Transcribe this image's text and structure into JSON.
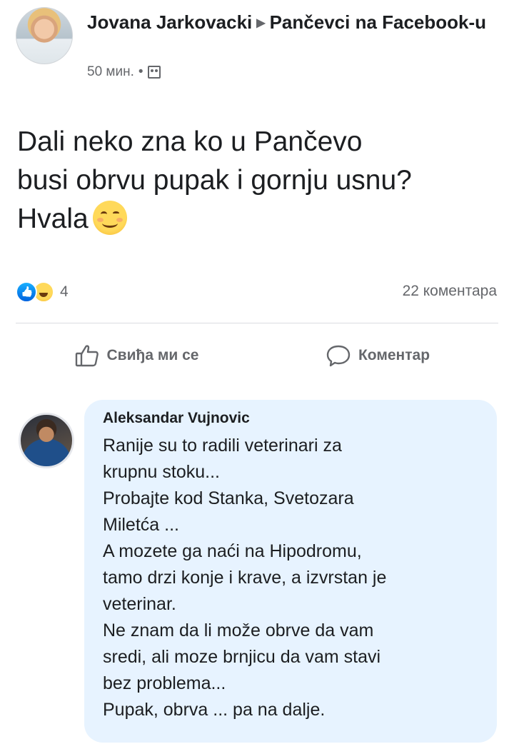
{
  "post": {
    "author": "Jovana Jarkovacki",
    "arrow": "▶",
    "group": "Pančevci na Facebook-u",
    "time": "50 мин.",
    "dot": "•",
    "text_lines": [
      "Dali neko zna ko u Pančevo",
      "busi obrvu pupak i gornju usnu?",
      "Hvala"
    ],
    "reaction_count": "4",
    "comments_count": "22 коментара",
    "like_label": "Свиђа ми се",
    "comment_label": "Коментар"
  },
  "comment": {
    "author": "Aleksandar Vujnovic",
    "lines": [
      "Ranije su to radili veterinari za",
      "krupnu stoku...",
      "Probajte kod Stanka, Svetozara",
      "Miletća ...",
      "A mozete ga naći na Hipodromu,",
      "tamo drzi konje i krave, a izvrstan je",
      "veterinar.",
      "Ne znam da li može obrve da vam",
      "sredi, ali moze brnjicu da vam stavi",
      "bez problema...",
      "Pupak, obrva ... pa na dalje."
    ]
  },
  "colors": {
    "bubble": "#e7f3ff",
    "meta": "#65676b",
    "text": "#1c1e21",
    "like_blue": "#0062df"
  },
  "icons": [
    "group-privacy-icon",
    "like-reaction-icon",
    "haha-reaction-icon",
    "thumbs-up-icon",
    "comment-bubble-icon",
    "smiling-emoji-icon"
  ]
}
